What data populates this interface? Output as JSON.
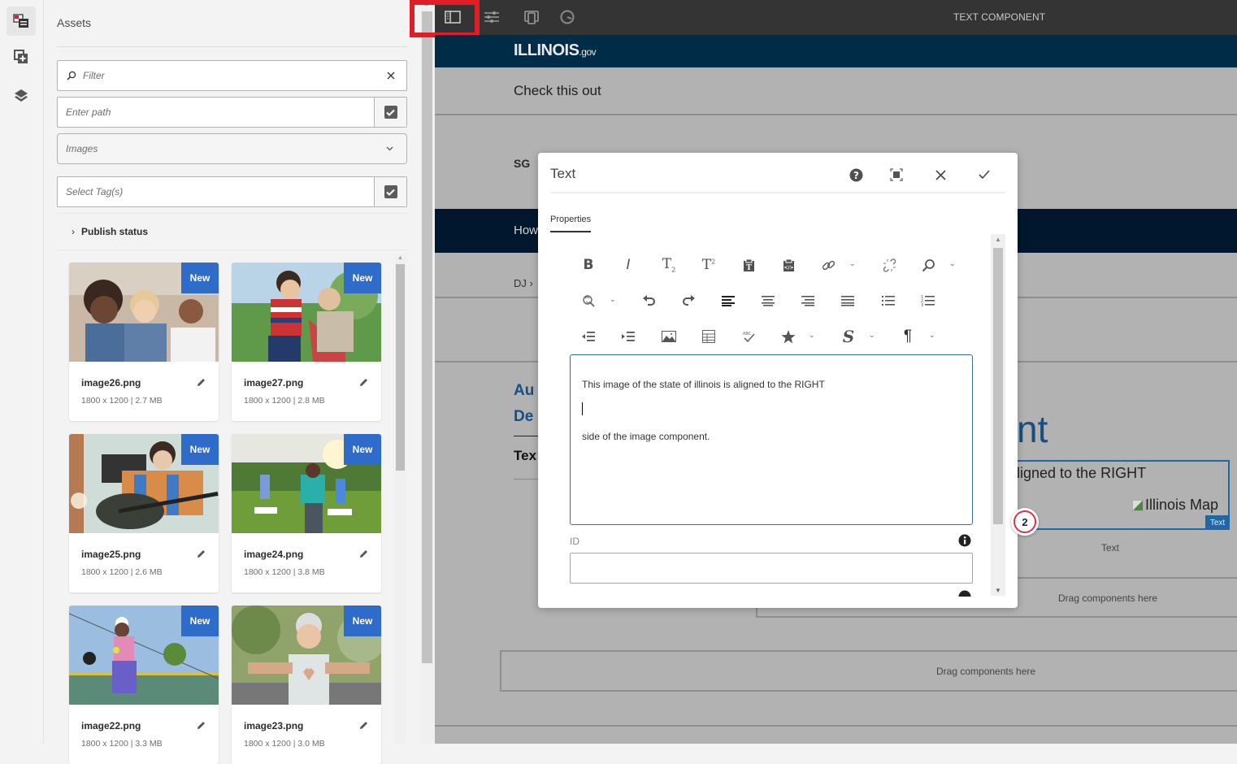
{
  "rail": {
    "items": [
      {
        "name": "assets",
        "icon": "assets-icon",
        "active": true
      },
      {
        "name": "components",
        "icon": "components-icon",
        "active": false
      },
      {
        "name": "content-tree",
        "icon": "layers-icon",
        "active": false
      }
    ]
  },
  "assets_panel": {
    "title": "Assets",
    "filter_placeholder": "Filter",
    "path_placeholder": "Enter path",
    "type_select": "Images",
    "tags_placeholder": "Select Tag(s)",
    "publish_status_label": "Publish status",
    "cards": [
      {
        "name": "image26.png",
        "meta": "1800 x 1200 | 2.7 MB",
        "badge": "New"
      },
      {
        "name": "image27.png",
        "meta": "1800 x 1200 | 2.8 MB",
        "badge": "New"
      },
      {
        "name": "image25.png",
        "meta": "1800 x 1200 | 2.6 MB",
        "badge": "New"
      },
      {
        "name": "image24.png",
        "meta": "1800 x 1200 | 3.8 MB",
        "badge": "New"
      },
      {
        "name": "image22.png",
        "meta": "1800 x 1200 | 3.3 MB",
        "badge": "New"
      },
      {
        "name": "image23.png",
        "meta": "1800 x 1200 | 3.0 MB",
        "badge": "New"
      }
    ]
  },
  "topbar": {
    "title": "TEXT COMPONENT",
    "icons": [
      "side-panel-toggle-icon",
      "page-properties-icon",
      "emulator-icon",
      "timewarp-icon"
    ]
  },
  "page": {
    "logo_main": "ILLINOIS",
    "logo_suffix": ".gov",
    "check_this_out": "Check this out",
    "sg_logo": "SG",
    "nav_text": "How",
    "breadcrumb": "DJ  ›",
    "heading_line1": "Au",
    "heading_line2": "De",
    "subheading": "Tex",
    "big_heading_fragment": "nt",
    "selected_component_text": "ligned to the RIGHT",
    "image_alt": "Illinois Map",
    "selected_component_tag": "Text",
    "component_label": "Text",
    "drag_zone_1": "Drag components here",
    "drag_zone_2": "Drag components here",
    "annotation_count": "2"
  },
  "dialog": {
    "title": "Text",
    "tab": "Properties",
    "actions": [
      "help",
      "fullscreen",
      "cancel",
      "done"
    ],
    "toolbar": {
      "bold": "B",
      "italic": "I",
      "subscript": "T",
      "superscript": "T",
      "paragraph_mark": "¶",
      "strikestyle": "S"
    },
    "editor_lines": [
      "This image of the state of illinois is aligned to the RIGHT",
      "",
      "side of the image component."
    ],
    "id_label": "ID",
    "id_value": ""
  },
  "colors": {
    "badge_blue": "#2f6bc9",
    "highlight_red": "#e01e26",
    "header_navy": "#002c47",
    "heading_blue": "#164f84",
    "selection_blue": "#2266a6"
  }
}
